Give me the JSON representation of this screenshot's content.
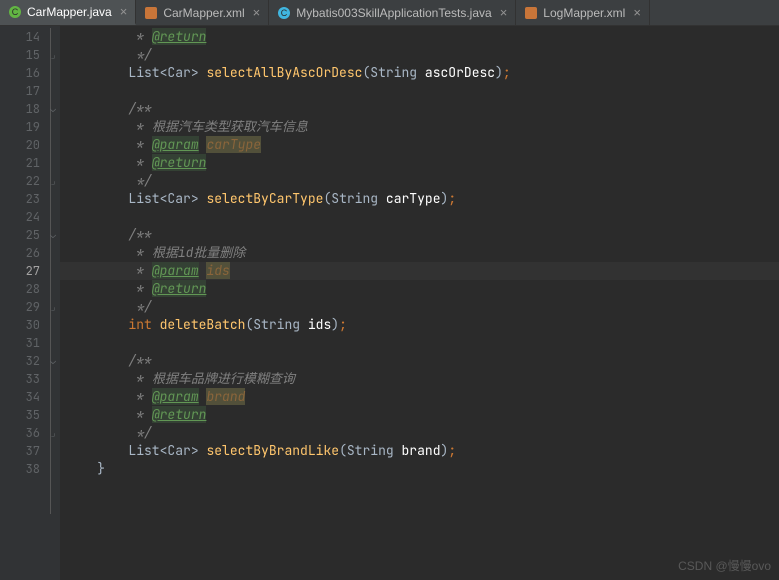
{
  "tabs": [
    {
      "label": "CarMapper.java",
      "icon_color": "#62b543",
      "active": true
    },
    {
      "label": "CarMapper.xml",
      "icon_color": "#c87539",
      "active": false
    },
    {
      "label": "Mybatis003SkillApplicationTests.java",
      "icon_color": "#40b6e0",
      "active": false
    },
    {
      "label": "LogMapper.xml",
      "icon_color": "#c87539",
      "active": false
    }
  ],
  "lineStart": 14,
  "currentLine": 27,
  "code": {
    "l14": {
      "indent": "         ",
      "star": "* ",
      "tag": "@return"
    },
    "l15": {
      "indent": "         ",
      "text": "*/"
    },
    "l16": {
      "indent": "        ",
      "ret_pre": "List",
      "ret_inner": "Car",
      "method": "selectAllByAscOrDesc",
      "ptype": "String",
      "pname": "ascOrDesc"
    },
    "l17": "",
    "l18": {
      "indent": "        ",
      "text": "/**"
    },
    "l19": {
      "indent": "         ",
      "star": "* ",
      "text": "根据汽车类型获取汽车信息"
    },
    "l20": {
      "indent": "         ",
      "star": "* ",
      "tag": "@param",
      "param": "carType"
    },
    "l21": {
      "indent": "         ",
      "star": "* ",
      "tag": "@return"
    },
    "l22": {
      "indent": "         ",
      "text": "*/"
    },
    "l23": {
      "indent": "        ",
      "ret_pre": "List",
      "ret_inner": "Car",
      "method": "selectByCarType",
      "ptype": "String",
      "pname": "carType"
    },
    "l24": "",
    "l25": {
      "indent": "        ",
      "text": "/**"
    },
    "l26": {
      "indent": "         ",
      "star": "* ",
      "text": "根据id批量删除"
    },
    "l27": {
      "indent": "         ",
      "star": "* ",
      "tag": "@param",
      "param": "ids"
    },
    "l28": {
      "indent": "         ",
      "star": "* ",
      "tag": "@return"
    },
    "l29": {
      "indent": "         ",
      "text": "*/"
    },
    "l30": {
      "indent": "        ",
      "ret_kw": "int",
      "method": "deleteBatch",
      "ptype": "String",
      "pname": "ids"
    },
    "l31": "",
    "l32": {
      "indent": "        ",
      "text": "/**"
    },
    "l33": {
      "indent": "         ",
      "star": "* ",
      "text": "根据车品牌进行模糊查询"
    },
    "l34": {
      "indent": "         ",
      "star": "* ",
      "tag": "@param",
      "param": "brand"
    },
    "l35": {
      "indent": "         ",
      "star": "* ",
      "tag": "@return"
    },
    "l36": {
      "indent": "         ",
      "text": "*/"
    },
    "l37": {
      "indent": "        ",
      "ret_pre": "List",
      "ret_inner": "Car",
      "method": "selectByBrandLike",
      "ptype": "String",
      "pname": "brand"
    },
    "l38": {
      "indent": "    ",
      "text": "}"
    }
  },
  "watermark": "CSDN @慢慢ovo"
}
